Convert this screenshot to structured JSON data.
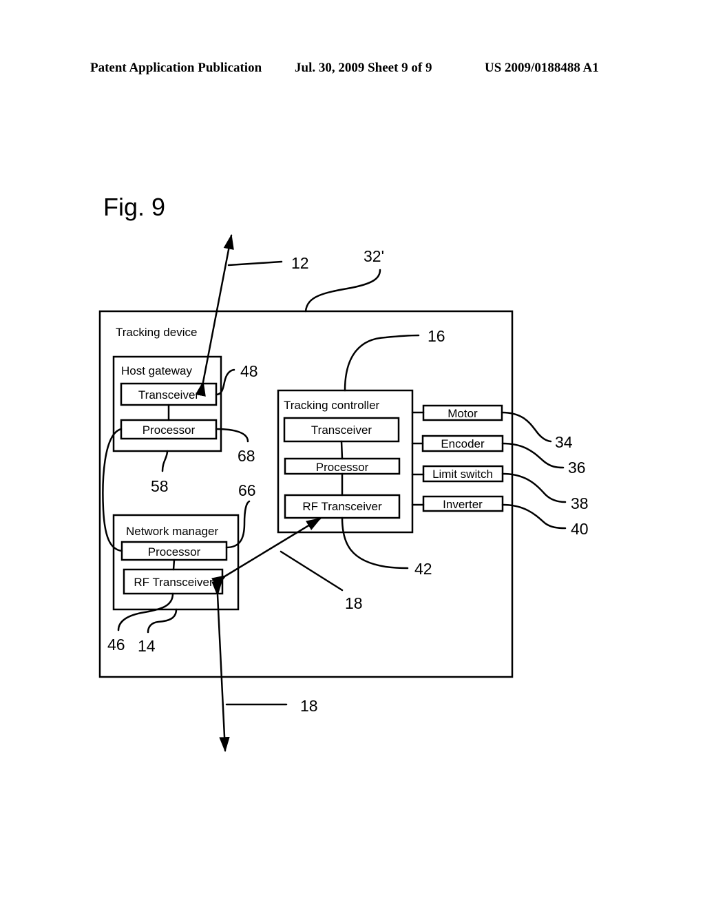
{
  "header": {
    "left": "Patent Application Publication",
    "date_sheet": "Jul. 30, 2009   Sheet 9 of 9",
    "number": "US 2009/0188488 A1"
  },
  "figure": {
    "label": "Fig. 9",
    "tracking_device": {
      "label": "Tracking device",
      "ref": "32'"
    },
    "host_gateway": {
      "label": "Host gateway",
      "transceiver": "Transceiver",
      "processor": "Processor",
      "refs": {
        "transceiver": "48",
        "processor": "68",
        "box": "58"
      }
    },
    "network_manager": {
      "label": "Network manager",
      "processor": "Processor",
      "rf_transceiver": "RF Transceiver",
      "refs": {
        "processor": "66",
        "rf_transceiver": "46",
        "box": "14"
      }
    },
    "tracking_controller": {
      "label": "Tracking controller",
      "transceiver": "Transceiver",
      "processor": "Processor",
      "rf_transceiver": "RF Transceiver",
      "refs": {
        "box": "16",
        "rf_transceiver": "42"
      }
    },
    "peripherals": [
      {
        "label": "Motor",
        "ref": "34"
      },
      {
        "label": "Encoder",
        "ref": "36"
      },
      {
        "label": "Limit switch",
        "ref": "38"
      },
      {
        "label": "Inverter",
        "ref": "40"
      }
    ],
    "links": {
      "host_link_ref": "12",
      "rf_link_ref": "18",
      "external_rf_link_ref": "18"
    }
  }
}
